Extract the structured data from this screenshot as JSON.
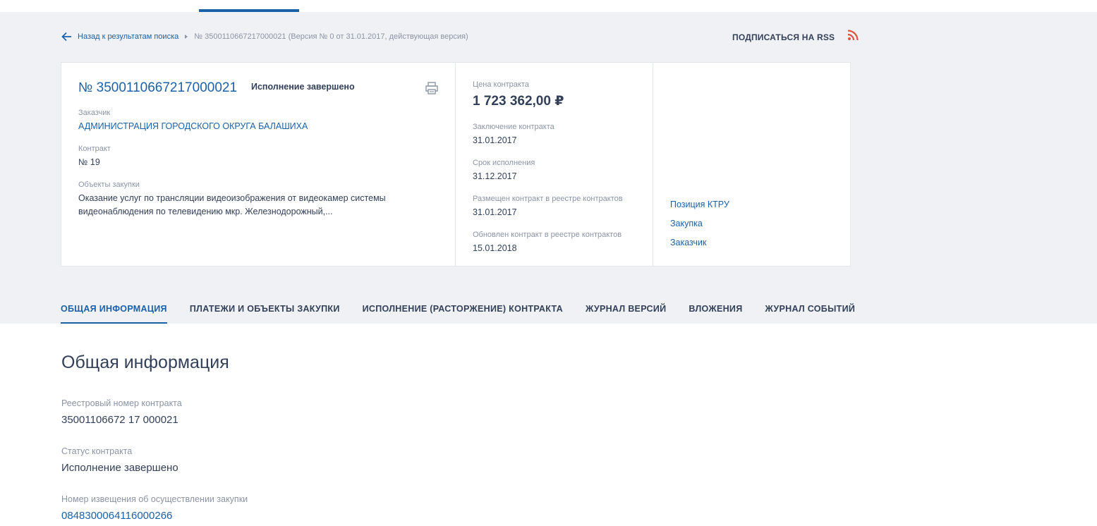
{
  "breadcrumb": {
    "back_label": "Назад к результатам поиска",
    "current": "№ 3500110667217000021 (Версия № 0 от 31.01.2017, действующая версия)"
  },
  "rss": {
    "label": "ПОДПИСАТЬСЯ НА RSS"
  },
  "card": {
    "contract_number": "№ 3500110667217000021",
    "status": "Исполнение завершено",
    "customer_label": "Заказчик",
    "customer_value": "АДМИНИСТРАЦИЯ ГОРОДСКОГО ОКРУГА БАЛАШИХА",
    "contract_label": "Контракт",
    "contract_value": "№ 19",
    "objects_label": "Объекты закупки",
    "objects_value": "Оказание услуг по трансляции видеоизображения от видеокамер системы видеонаблюдения по телевидению мкр. Железнодорожный,...",
    "price_label": "Цена контракта",
    "price_value": "1 723 362,00 ₽",
    "conclusion_label": "Заключение контракта",
    "conclusion_value": "31.01.2017",
    "term_label": "Срок исполнения",
    "term_value": "31.12.2017",
    "placed_label": "Размещен контракт в реестре контрактов",
    "placed_value": "31.01.2017",
    "updated_label": "Обновлен контракт в реестре контрактов",
    "updated_value": "15.01.2018",
    "links": [
      "Позиция КТРУ",
      "Закупка",
      "Заказчик"
    ]
  },
  "tabs": [
    "ОБЩАЯ ИНФОРМАЦИЯ",
    "ПЛАТЕЖИ И ОБЪЕКТЫ ЗАКУПКИ",
    "ИСПОЛНЕНИЕ (РАСТОРЖЕНИЕ) КОНТРАКТА",
    "ЖУРНАЛ ВЕРСИЙ",
    "ВЛОЖЕНИЯ",
    "ЖУРНАЛ СОБЫТИЙ"
  ],
  "main": {
    "title": "Общая информация",
    "registry_label": "Реестровый номер контракта",
    "registry_value": "35001106672 17 000021",
    "status_label": "Статус контракта",
    "status_value": "Исполнение завершено",
    "notice_label": "Номер извещения об осуществлении закупки",
    "notice_value": "0848300064116000266"
  },
  "colors": {
    "accent": "#1a61a8",
    "text": "#334059",
    "muted": "#8b94a5",
    "rss": "#e0533d",
    "background_grey": "#eff1f4"
  }
}
